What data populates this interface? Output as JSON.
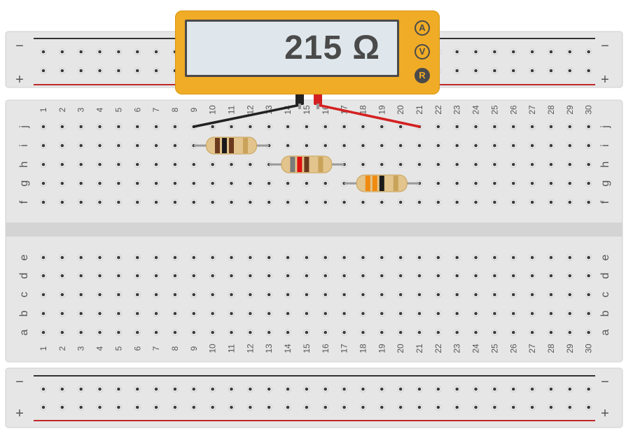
{
  "multimeter": {
    "reading": "215 Ω",
    "modes": [
      {
        "label": "A",
        "active": false
      },
      {
        "label": "V",
        "active": false
      },
      {
        "label": "R",
        "active": true
      }
    ]
  },
  "breadboard": {
    "columns": 30,
    "top_rows": [
      "j",
      "i",
      "h",
      "g",
      "f"
    ],
    "bottom_rows": [
      "e",
      "d",
      "c",
      "b",
      "a"
    ],
    "rail_minus_label": "−",
    "rail_plus_label": "+"
  },
  "resistors": [
    {
      "name": "resistor-1",
      "from_col": 9,
      "to_col": 13,
      "row": "i",
      "bands": [
        "#6b3a1e",
        "#1a1a1a",
        "#6b3a1e",
        "#c9a35a"
      ]
    },
    {
      "name": "resistor-2",
      "from_col": 13,
      "to_col": 17,
      "row": "h",
      "bands": [
        "#7a7a7a",
        "#e01010",
        "#6b3a1e",
        "#c9a35a"
      ]
    },
    {
      "name": "resistor-3",
      "from_col": 17,
      "to_col": 21,
      "row": "g",
      "bands": [
        "#f08a10",
        "#f08a10",
        "#1a1a1a",
        "#c9a35a"
      ]
    }
  ],
  "probes": {
    "black": {
      "color": "#222222",
      "to_col": 9,
      "row": "j"
    },
    "red": {
      "color": "#d42020",
      "to_col": 21,
      "row": "j"
    }
  },
  "colors": {
    "board": "#e6e6e6",
    "rail_minus": "#333333",
    "rail_plus": "#c0282b",
    "meter_body": "#f0ac26"
  }
}
